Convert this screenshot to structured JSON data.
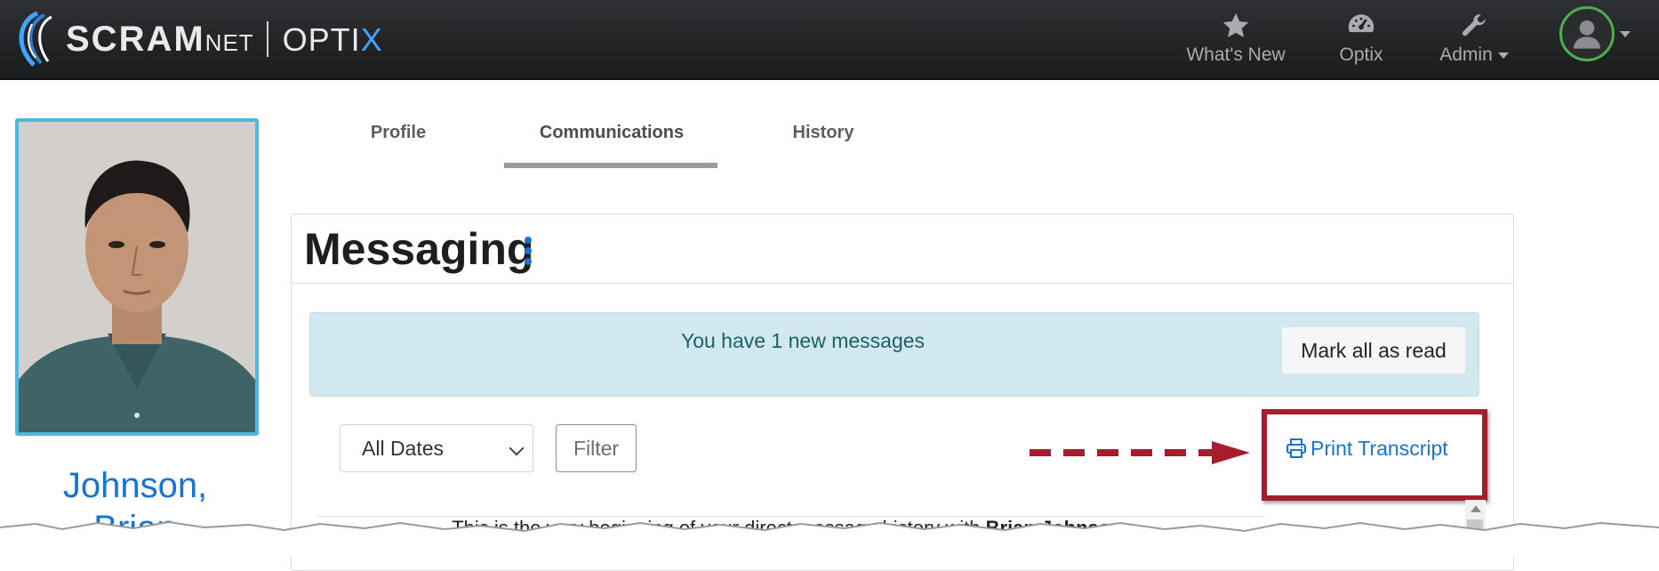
{
  "brand": {
    "scram": "SCRAM",
    "net": "NET",
    "optix_prefix": "OPTI",
    "optix_x": "X"
  },
  "topnav": {
    "items": [
      {
        "label": "What's New",
        "icon": "star-icon"
      },
      {
        "label": "Optix",
        "icon": "dashboard-gauge-icon"
      },
      {
        "label": "Admin",
        "icon": "wrench-icon"
      }
    ],
    "avatar_icon": "user-icon",
    "colors": {
      "bar": "#222325",
      "avatar_ring": "#4caf50"
    }
  },
  "profile": {
    "name_line1": "Johnson,",
    "name_line2": "Brian"
  },
  "tabs": [
    {
      "label": "Profile"
    },
    {
      "label": "Communications"
    },
    {
      "label": "History"
    }
  ],
  "messaging": {
    "title": "Messaging",
    "alert_text": "You have 1 new messages",
    "mark_all_read": "Mark all as read",
    "date_filter_value": "All Dates",
    "filter_label": "Filter",
    "print_label": "Print Transcript",
    "history_prefix": "This is the very beginning of your direct message history with ",
    "history_name": "Brian Johnson",
    "history_suffix": "."
  },
  "colors": {
    "accent_blue": "#1a73d1",
    "alert_bg": "#d1e9ee",
    "highlight_red": "#a81d2c",
    "photo_border": "#4cb9dd"
  }
}
